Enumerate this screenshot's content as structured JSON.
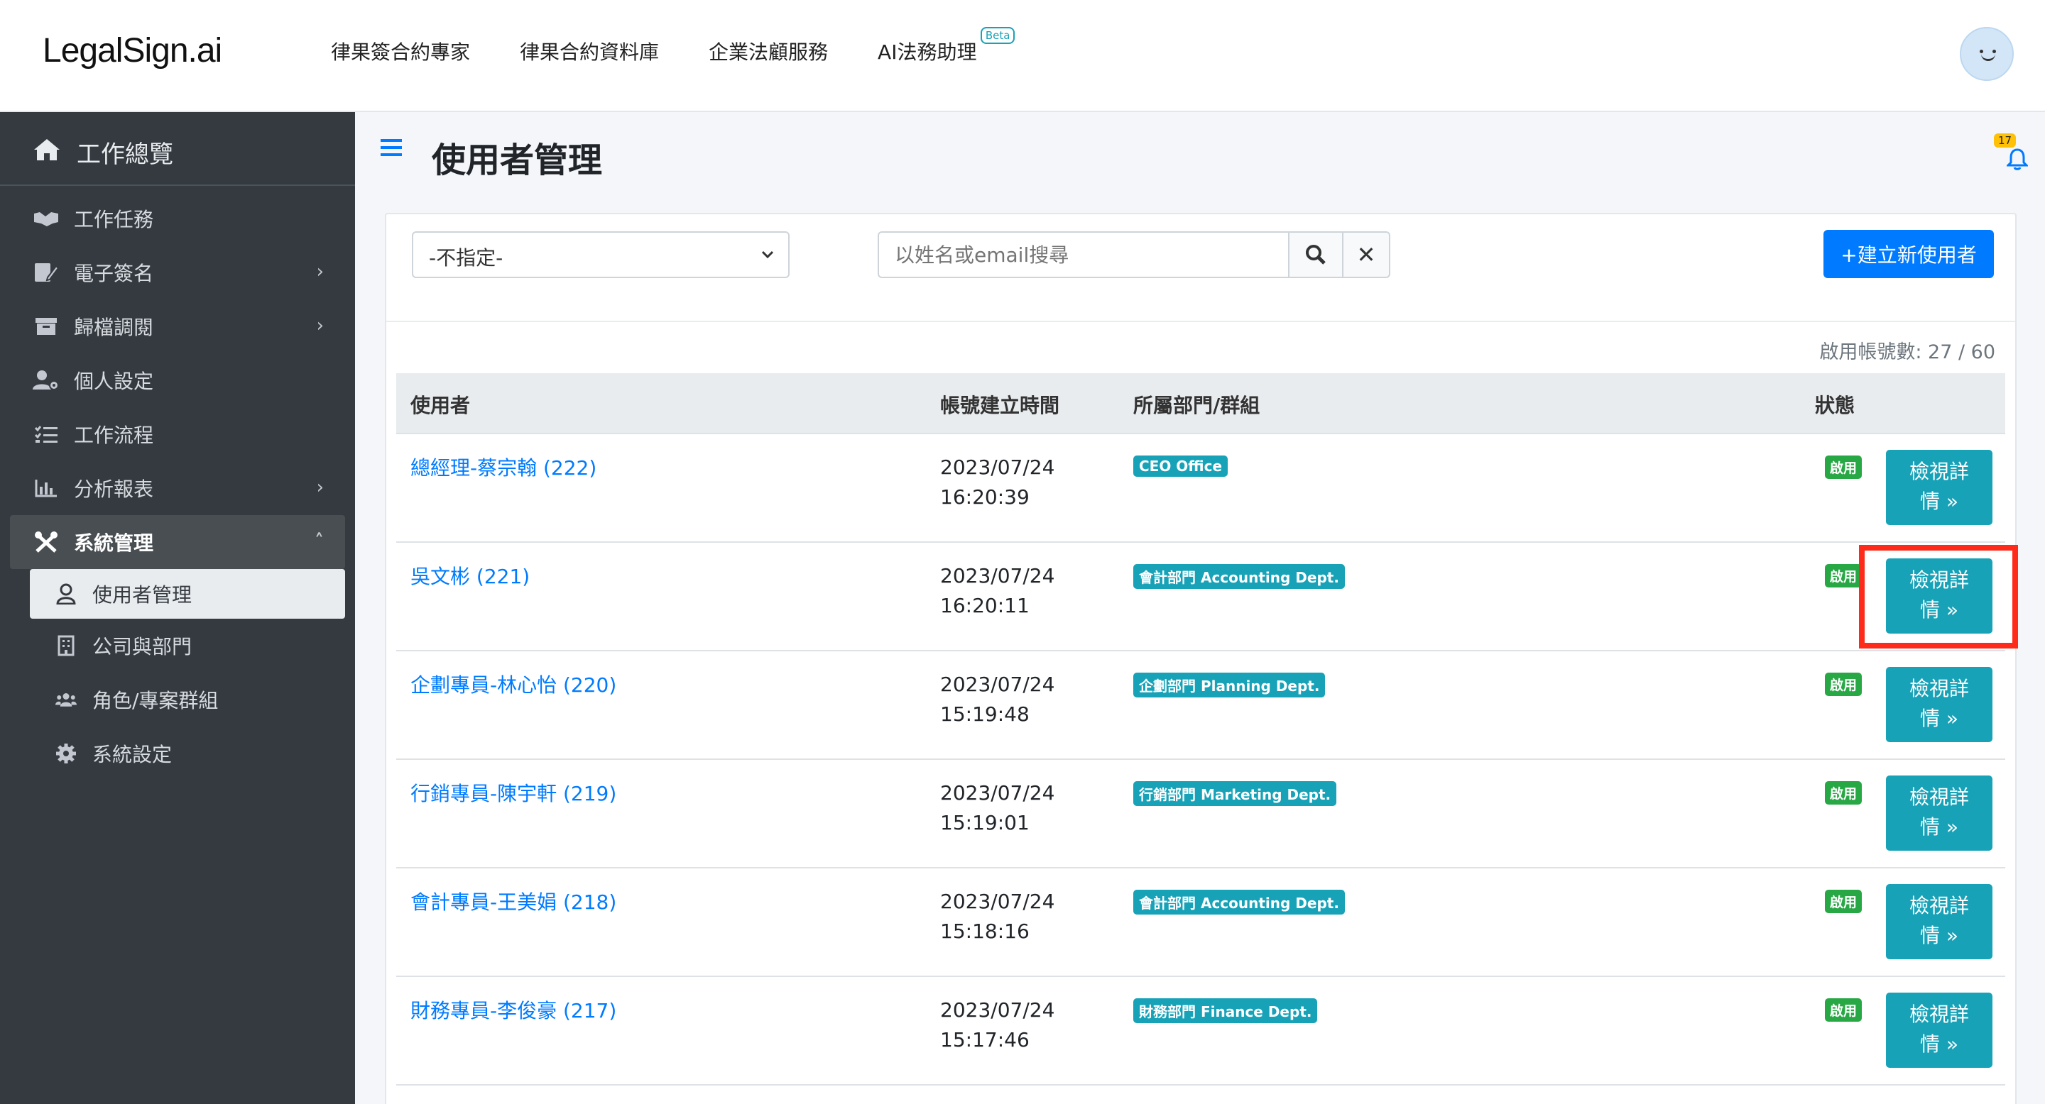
{
  "brand": {
    "logo": "LegalSign.ai"
  },
  "topnav": [
    "律果簽合約專家",
    "律果合約資料庫",
    "企業法顧服務",
    "AI法務助理"
  ],
  "topnav_beta": "Beta",
  "sidebar": {
    "title": "工作總覽",
    "items": [
      {
        "label": "工作任務"
      },
      {
        "label": "電子簽名"
      },
      {
        "label": "歸檔調閱"
      },
      {
        "label": "個人設定"
      },
      {
        "label": "工作流程"
      },
      {
        "label": "分析報表"
      },
      {
        "label": "系統管理"
      }
    ],
    "subitems": [
      {
        "label": "使用者管理"
      },
      {
        "label": "公司與部門"
      },
      {
        "label": "角色/專案群組"
      },
      {
        "label": "系統設定"
      }
    ]
  },
  "page": {
    "title": "使用者管理",
    "notifications": "17"
  },
  "filter": {
    "select_value": "-不指定-",
    "search_placeholder": "以姓名或email搜尋",
    "create_label": "+建立新使用者"
  },
  "account_count": "啟用帳號數: 27 / 60",
  "table": {
    "headers": [
      "使用者",
      "帳號建立時間",
      "所屬部門/群組",
      "狀態"
    ],
    "button_line1": "檢視詳",
    "button_line2": "情 »",
    "rows": [
      {
        "user": "總經理-蔡宗翰 (222)",
        "date": "2023/07/24",
        "time": "16:20:39",
        "dept": "CEO Office",
        "status": "啟用"
      },
      {
        "user": "吳文彬 (221)",
        "date": "2023/07/24",
        "time": "16:20:11",
        "dept": "會計部門 Accounting Dept.",
        "status": "啟用"
      },
      {
        "user": "企劃專員-林心怡 (220)",
        "date": "2023/07/24",
        "time": "15:19:48",
        "dept": "企劃部門 Planning Dept.",
        "status": "啟用"
      },
      {
        "user": "行銷專員-陳宇軒 (219)",
        "date": "2023/07/24",
        "time": "15:19:01",
        "dept": "行銷部門 Marketing Dept.",
        "status": "啟用"
      },
      {
        "user": "會計專員-王美娟 (218)",
        "date": "2023/07/24",
        "time": "15:18:16",
        "dept": "會計部門 Accounting Dept.",
        "status": "啟用"
      },
      {
        "user": "財務專員-李俊豪 (217)",
        "date": "2023/07/24",
        "time": "15:17:46",
        "dept": "財務部門 Finance Dept.",
        "status": "啟用"
      }
    ]
  },
  "colors": {
    "primary": "#007bff",
    "info": "#17a2b8",
    "success": "#28a745",
    "sidebar": "#343a40",
    "highlight": "#ff2a1a"
  }
}
